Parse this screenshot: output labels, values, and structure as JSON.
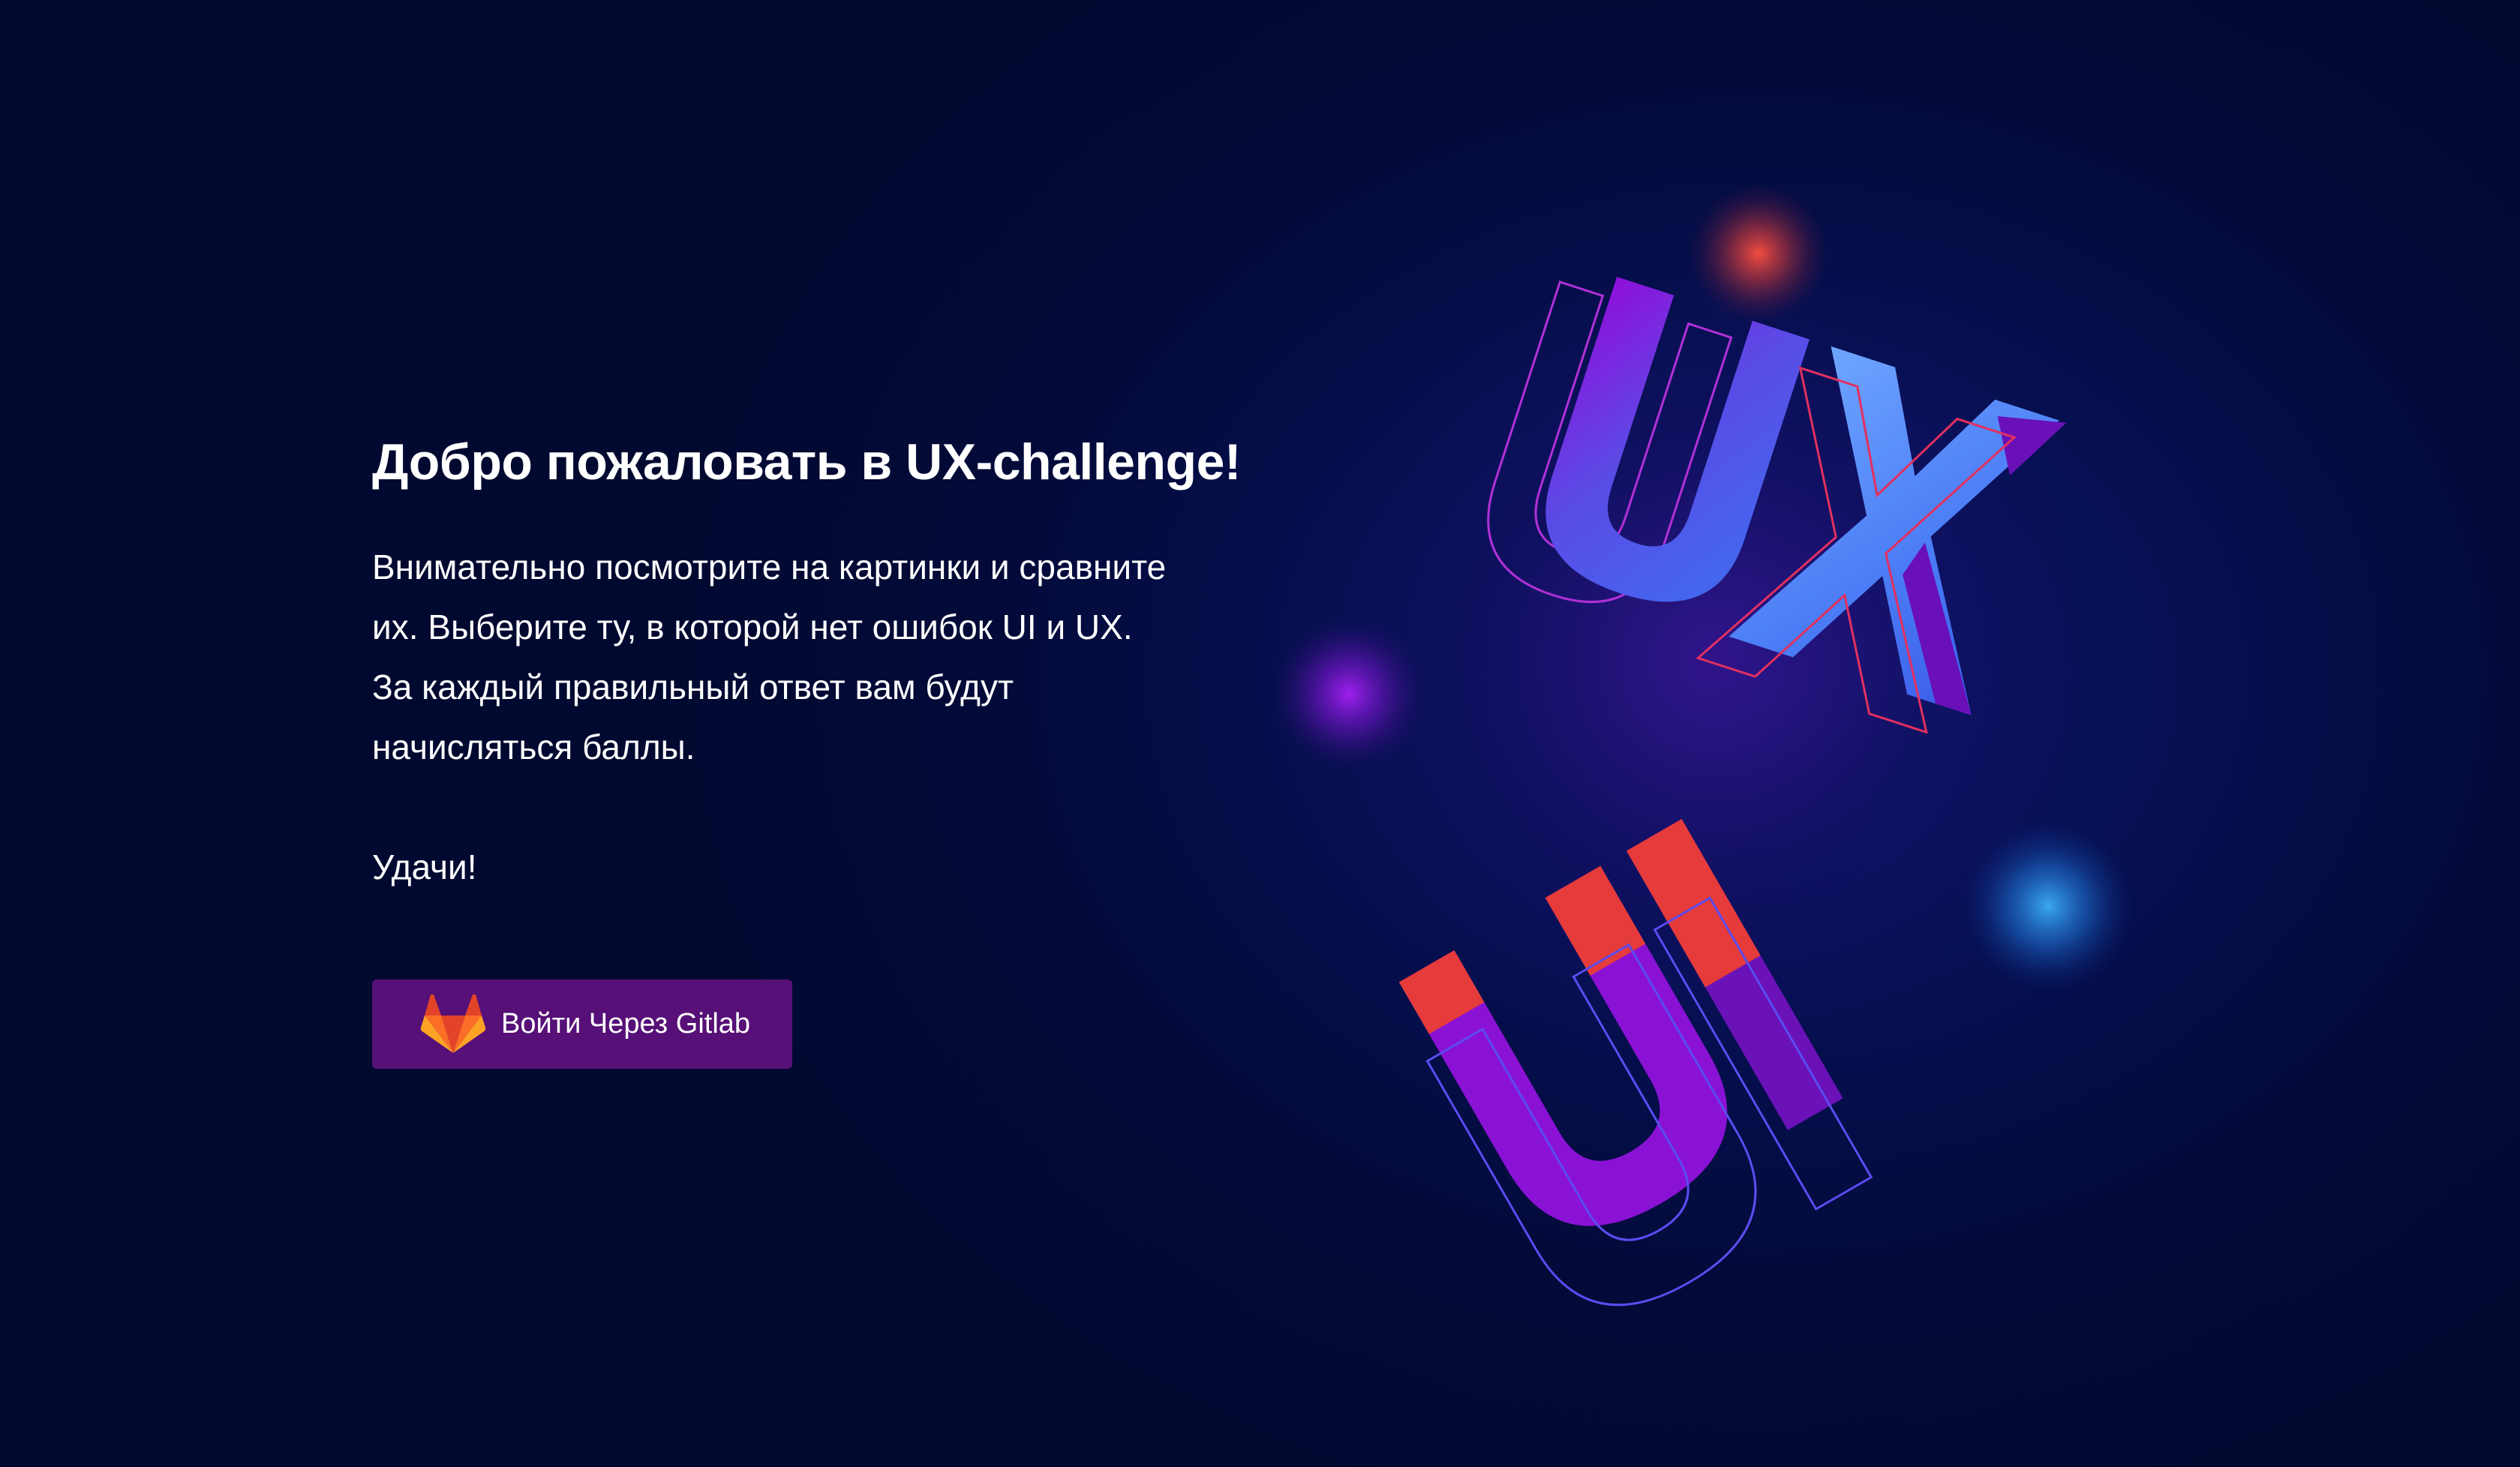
{
  "page": {
    "title": "Добро пожаловать в UX-challenge!",
    "intro_lines": [
      "Внимательно посмотрите на картинки и сравните",
      "их. Выберите ту, в которой нет ошибок UI и UX.",
      "За каждый правильный ответ вам будут",
      "начисляться баллы."
    ],
    "luck": "Удачи!"
  },
  "login_button": {
    "label": "Войти Через Gitlab",
    "icon": "gitlab-icon"
  },
  "illustration": {
    "letters_top": "UX",
    "letters_bottom": "UI"
  },
  "colors": {
    "background": "#030a33",
    "button": "#561077",
    "accent_purple": "#8a0fd8",
    "accent_blue": "#4f7ef5",
    "accent_red": "#e63a3a",
    "text": "#ffffff"
  }
}
